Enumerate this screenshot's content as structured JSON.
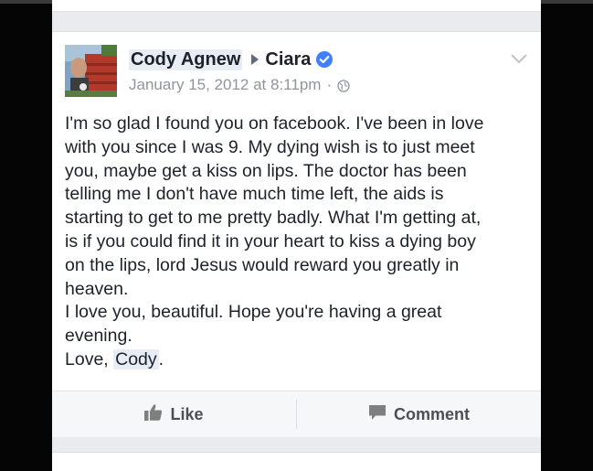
{
  "post": {
    "author": "Cody Agnew",
    "recipient": "Ciara",
    "date": "January 15, 2012 at 8:11pm",
    "meta_separator": "·",
    "body_lines": [
      "I'm so glad I found you on facebook. I've been in love",
      "with you since I was 9. My dying wish is to just meet",
      "you, maybe get a kiss on lips. The doctor has been",
      "telling me I don't have much time left, the aids is",
      "starting to get to me pretty badly. What I'm getting at,",
      "is if you could find it in your heart to kiss a dying boy",
      "on the lips, lord Jesus would reward you greatly in",
      "heaven.",
      "I love you, beautiful. Hope you're having a great",
      "evening."
    ],
    "signoff_prefix": "Love, ",
    "signoff_name": "Cody",
    "signoff_suffix": "."
  },
  "actions": {
    "like_label": "Like",
    "comment_label": "Comment"
  },
  "icons": {
    "arrow": "right-triangle-icon",
    "verified": "verified-badge-icon",
    "privacy": "globe-icon",
    "menu": "chevron-down-icon",
    "like": "thumbs-up-icon",
    "comment": "speech-bubble-icon"
  },
  "colors": {
    "verified_blue": "#4080ff",
    "text": "#1d2129",
    "meta": "#90949c",
    "action_text": "#4b4f56"
  }
}
